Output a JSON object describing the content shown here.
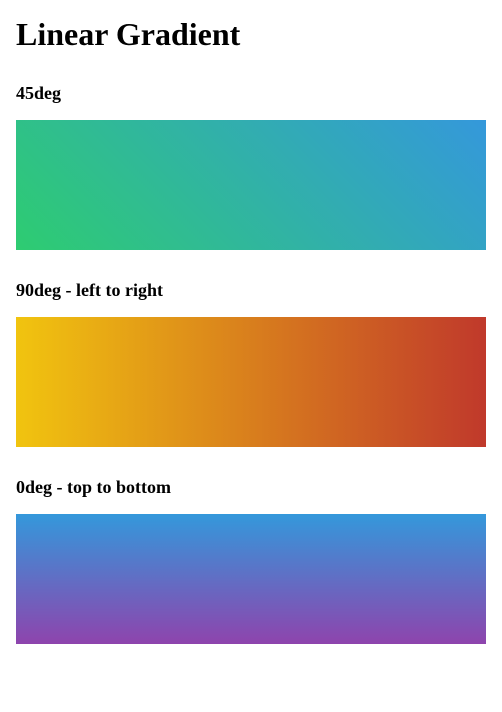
{
  "page": {
    "title": "Linear Gradient"
  },
  "sections": [
    {
      "heading": "45deg",
      "gradient": {
        "angle": "45deg",
        "colors": [
          "#2ecc71",
          "#3498db"
        ]
      }
    },
    {
      "heading": "90deg - left to right",
      "gradient": {
        "angle": "90deg",
        "colors": [
          "#f1c40f",
          "#c0392b"
        ]
      }
    },
    {
      "heading": "0deg - top to bottom",
      "gradient": {
        "angle": "180deg",
        "colors": [
          "#3498db",
          "#8e44ad"
        ]
      }
    }
  ]
}
